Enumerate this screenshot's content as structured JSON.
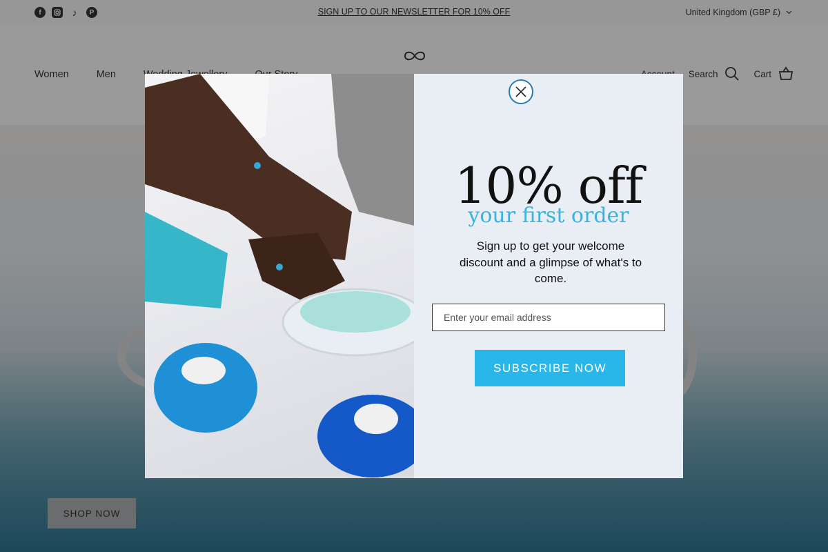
{
  "announcement": {
    "text": "SIGN UP TO OUR NEWSLETTER FOR 10% OFF",
    "country": "United Kingdom (GBP £)",
    "socials": [
      "facebook-icon",
      "instagram-icon",
      "tiktok-icon",
      "pinterest-icon"
    ]
  },
  "header": {
    "nav": [
      "Women",
      "Men",
      "Wedding Jewellery",
      "Our Story"
    ],
    "account": "Account",
    "search": "Search",
    "cart": "Cart"
  },
  "hero": {
    "cta": "SHOP NOW"
  },
  "popup": {
    "headline": "10% off",
    "subheadline": "your first order",
    "description": "Sign up to get your welcome discount and a glimpse of what's to come.",
    "email_placeholder": "Enter your email address",
    "submit_label": "SUBSCRIBE NOW"
  },
  "colors": {
    "accent": "#29b6e8",
    "close_ring": "#2a7ab8",
    "popup_bg": "#e8eef3"
  }
}
